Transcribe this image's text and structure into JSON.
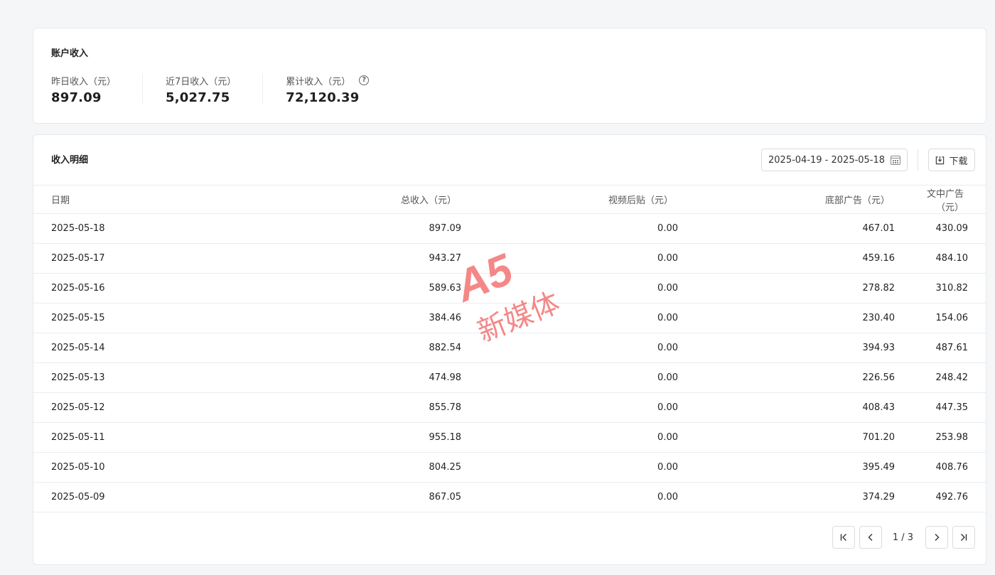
{
  "summary": {
    "title": "账户收入",
    "stats": [
      {
        "label": "昨日收入（元）",
        "value": "897.09"
      },
      {
        "label": "近7日收入（元）",
        "value": "5,027.75"
      },
      {
        "label": "累计收入（元）",
        "value": "72,120.39"
      }
    ]
  },
  "detail": {
    "title": "收入明细",
    "date_range": "2025-04-19 - 2025-05-18",
    "download_label": "下载",
    "columns": [
      "日期",
      "总收入（元）",
      "视频后贴（元）",
      "底部广告（元）",
      "文中广告（元）"
    ],
    "rows": [
      [
        "2025-05-18",
        "897.09",
        "0.00",
        "467.01",
        "430.09"
      ],
      [
        "2025-05-17",
        "943.27",
        "0.00",
        "459.16",
        "484.10"
      ],
      [
        "2025-05-16",
        "589.63",
        "0.00",
        "278.82",
        "310.82"
      ],
      [
        "2025-05-15",
        "384.46",
        "0.00",
        "230.40",
        "154.06"
      ],
      [
        "2025-05-14",
        "882.54",
        "0.00",
        "394.93",
        "487.61"
      ],
      [
        "2025-05-13",
        "474.98",
        "0.00",
        "226.56",
        "248.42"
      ],
      [
        "2025-05-12",
        "855.78",
        "0.00",
        "408.43",
        "447.35"
      ],
      [
        "2025-05-11",
        "955.18",
        "0.00",
        "701.20",
        "253.98"
      ],
      [
        "2025-05-10",
        "804.25",
        "0.00",
        "395.49",
        "408.76"
      ],
      [
        "2025-05-09",
        "867.05",
        "0.00",
        "374.29",
        "492.76"
      ]
    ],
    "pagination": "1 / 3"
  },
  "watermark": {
    "logo_text": "A5",
    "text": "新媒体",
    "color": "#f26b6b"
  },
  "icons": {
    "help": "help-circle-icon",
    "calendar": "calendar-icon",
    "download": "download-icon",
    "first": "first-page-icon",
    "prev": "chevron-left-icon",
    "next": "chevron-right-icon",
    "last": "last-page-icon"
  }
}
